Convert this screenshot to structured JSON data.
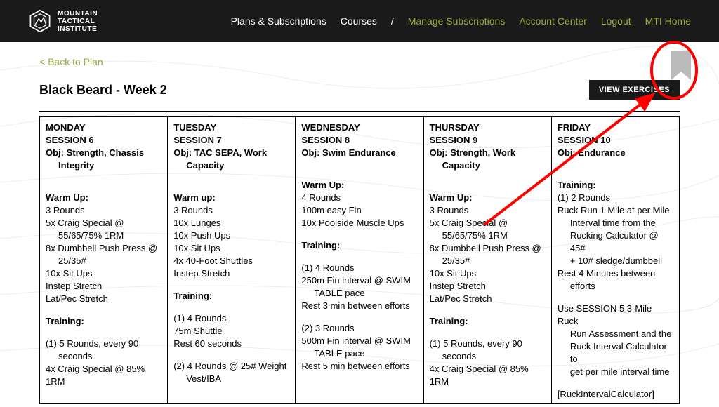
{
  "brand": {
    "l1": "MOUNTAIN",
    "l2": "TACTICAL",
    "l3": "INSTITUTE"
  },
  "nav": {
    "plans": "Plans & Subscriptions",
    "courses": "Courses",
    "sep": "/",
    "manage": "Manage Subscriptions",
    "account": "Account Center",
    "logout": "Logout",
    "home": "MTI Home"
  },
  "back": "< Back to Plan",
  "title": "Black Beard - Week 2",
  "viewExercises": "VIEW EXERCISES",
  "cols": [
    {
      "day": "MONDAY",
      "session": "SESSION 6",
      "obj": "Obj: Strength, Chassis",
      "obj2": "Integrity",
      "warmLabel": "Warm Up:",
      "warm": [
        "3 Rounds",
        "5x Craig Special @",
        "55/65/75% 1RM",
        "8x Dumbbell Push Press @",
        "25/35#",
        "10x Sit Ups",
        "Instep Stretch",
        "Lat/Pec Stretch"
      ],
      "warmIndent": [
        false,
        false,
        true,
        false,
        true,
        false,
        false,
        false
      ],
      "trainLabel": "Training:",
      "train": [
        "(1) 5 Rounds, every 90",
        "seconds",
        "4x Craig Special @ 85% 1RM"
      ],
      "trainIndent": [
        false,
        true,
        false
      ]
    },
    {
      "day": "TUESDAY",
      "session": "SESSION 7",
      "obj": "Obj: TAC SEPA, Work",
      "obj2": "Capacity",
      "warmLabel": "Warm up:",
      "warm": [
        "3 Rounds",
        "10x Lunges",
        "10x Push Ups",
        "10x Sit Ups",
        "4x 40-Foot Shuttles",
        "Instep Stretch"
      ],
      "warmIndent": [
        false,
        false,
        false,
        false,
        false,
        false
      ],
      "trainLabel": "Training:",
      "train": [
        "(1) 4 Rounds",
        "75m Shuttle",
        "Rest 60 seconds",
        "",
        "(2) 4 Rounds @ 25# Weight",
        "Vest/IBA"
      ],
      "trainIndent": [
        false,
        false,
        false,
        false,
        false,
        true
      ]
    },
    {
      "day": "WEDNESDAY",
      "session": "SESSION 8",
      "obj": "Obj: Swim Endurance",
      "obj2": "",
      "warmLabel": "Warm Up:",
      "warm": [
        "4 Rounds",
        "100m easy Fin",
        "10x Poolside Muscle Ups"
      ],
      "warmIndent": [
        false,
        false,
        false
      ],
      "trainLabel": "Training:",
      "train": [
        "(1) 4 Rounds",
        "250m Fin interval @ SWIM",
        "TABLE pace",
        "Rest 3 min between efforts",
        "",
        "(2) 3 Rounds",
        "500m Fin interval @ SWIM",
        "TABLE pace",
        "Rest 5 min between efforts"
      ],
      "trainIndent": [
        false,
        false,
        true,
        false,
        false,
        false,
        false,
        true,
        false
      ]
    },
    {
      "day": "THURSDAY",
      "session": "SESSION 9",
      "obj": "Obj: Strength, Work",
      "obj2": "Capacity",
      "warmLabel": "Warm Up:",
      "warm": [
        "3 Rounds",
        "5x Craig Special @",
        "55/65/75% 1RM",
        "8x Dumbbell Push Press @",
        "25/35#",
        "10x Sit Ups",
        "Instep Stretch",
        "Lat/Pec Stretch"
      ],
      "warmIndent": [
        false,
        false,
        true,
        false,
        true,
        false,
        false,
        false
      ],
      "trainLabel": "Training:",
      "train": [
        "(1) 5 Rounds, every 90",
        "seconds",
        "4x Craig Special @ 85% 1RM"
      ],
      "trainIndent": [
        false,
        true,
        false
      ]
    },
    {
      "day": "FRIDAY",
      "session": "SESSION 10",
      "obj": "Obj: Endurance",
      "obj2": "",
      "warmLabel": "Training:",
      "warm": [
        "(1) 2 Rounds",
        "Ruck Run 1 Mile at per Mile",
        "Interval time from the",
        "Rucking Calculator @ 45#",
        "+ 10# sledge/dumbbell",
        "Rest 4 Minutes between",
        "efforts",
        "",
        "Use SESSION 5 3-Mile Ruck",
        "Run Assessment and the",
        "Ruck Interval Calculator to",
        "get per mile interval time",
        "",
        "[RuckIntervalCalculator]"
      ],
      "warmIndent": [
        false,
        false,
        true,
        true,
        true,
        false,
        true,
        false,
        false,
        true,
        true,
        true,
        false,
        false
      ],
      "trainLabel": "",
      "train": [],
      "trainIndent": []
    }
  ]
}
